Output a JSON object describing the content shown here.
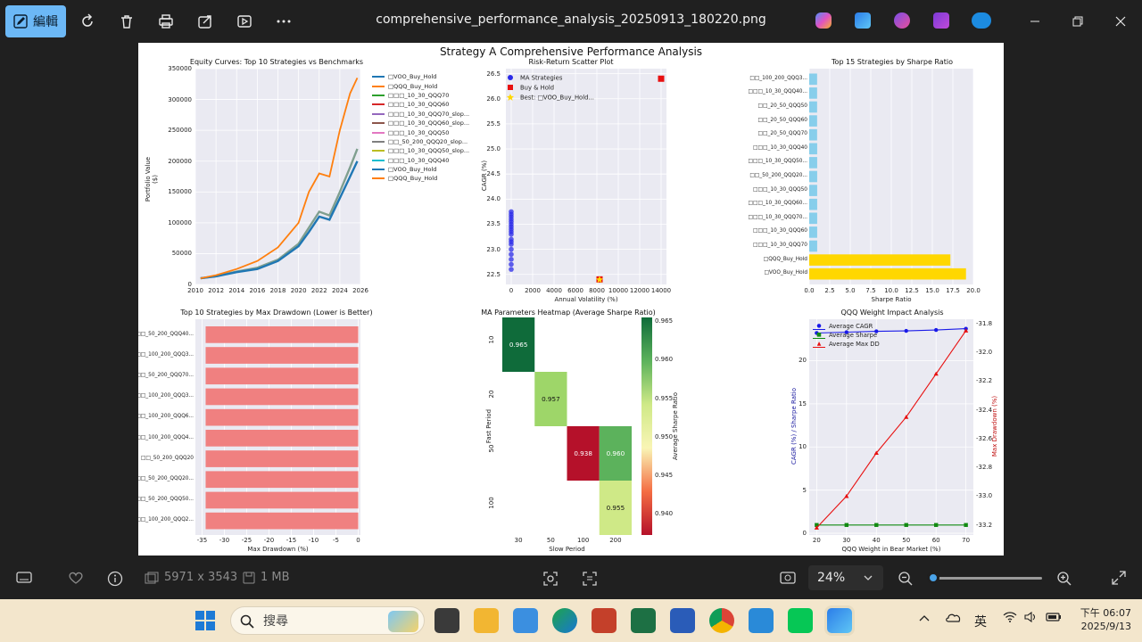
{
  "window": {
    "title": "comprehensive_performance_analysis_20250913_180220.png",
    "edit_label": "編輯"
  },
  "figure": {
    "title": "Strategy A Comprehensive Performance Analysis",
    "equity": {
      "title": "Equity Curves: Top 10 Strategies vs Benchmarks",
      "ylabel": "Portfolio Value ($)",
      "y_ticks": [
        "350000",
        "300000",
        "250000",
        "200000",
        "150000",
        "100000",
        "50000",
        "0"
      ],
      "x_ticks": [
        "2010",
        "2012",
        "2014",
        "2016",
        "2018",
        "2020",
        "2022",
        "2024",
        "2026"
      ],
      "legend": [
        {
          "name": "□VOO_Buy_Hold",
          "color": "#1f77b4"
        },
        {
          "name": "□QQQ_Buy_Hold",
          "color": "#ff7f0e"
        },
        {
          "name": "□□□_10_30_QQQ70",
          "color": "#2ca02c"
        },
        {
          "name": "□□□_10_30_QQQ60",
          "color": "#d62728"
        },
        {
          "name": "□□□_10_30_QQQ70_slop...",
          "color": "#9467bd"
        },
        {
          "name": "□□□_10_30_QQQ60_slop...",
          "color": "#8c564b"
        },
        {
          "name": "□□□_10_30_QQQ50",
          "color": "#e377c2"
        },
        {
          "name": "□□_50_200_QQQ20_slop...",
          "color": "#7f7f7f"
        },
        {
          "name": "□□□_10_30_QQQ50_slop...",
          "color": "#bcbd22"
        },
        {
          "name": "□□□_10_30_QQQ40",
          "color": "#17becf"
        },
        {
          "name": "□VOO_Buy_Hold",
          "color": "#1f77b4"
        },
        {
          "name": "□QQQ_Buy_Hold",
          "color": "#ff7f0e"
        }
      ]
    },
    "scatter": {
      "title": "Risk-Return Scatter Plot",
      "xlabel": "Annual Volatility (%)",
      "ylabel": "CAGR (%)",
      "y_ticks": [
        "26.5",
        "26.0",
        "25.5",
        "25.0",
        "24.5",
        "24.0",
        "23.5",
        "23.0",
        "22.5"
      ],
      "x_ticks": [
        "0",
        "2000",
        "4000",
        "6000",
        "8000",
        "10000",
        "12000",
        "14000"
      ],
      "legend": [
        "MA Strategies",
        "Buy & Hold",
        "Best: □VOO_Buy_Hold..."
      ]
    },
    "sharpe": {
      "title": "Top 15 Strategies by Sharpe Ratio",
      "xlabel": "Sharpe Ratio",
      "x_ticks": [
        "0.0",
        "2.5",
        "5.0",
        "7.5",
        "10.0",
        "12.5",
        "15.0",
        "17.5",
        "20.0"
      ],
      "labels": [
        "□□_100_200_QQQ3...",
        "□□□_10_30_QQQ40...",
        "□□_20_50_QQQ50",
        "□□_20_50_QQQ60",
        "□□_20_50_QQQ70",
        "□□□_10_30_QQQ40",
        "□□□_10_30_QQQ50...",
        "□□_50_200_QQQ20...",
        "□□□_10_30_QQQ50",
        "□□□_10_30_QQQ60...",
        "□□□_10_30_QQQ70...",
        "□□□_10_30_QQQ60",
        "□□□_10_30_QQQ70",
        "□QQQ_Buy_Hold",
        "□VOO_Buy_Hold"
      ],
      "colors": [
        "#87ceeb",
        "#87ceeb",
        "#87ceeb",
        "#87ceeb",
        "#87ceeb",
        "#87ceeb",
        "#87ceeb",
        "#87ceeb",
        "#87ceeb",
        "#87ceeb",
        "#87ceeb",
        "#87ceeb",
        "#87ceeb",
        "#ffd700",
        "#ffd700"
      ]
    },
    "drawdown": {
      "title": "Top 10 Strategies by Max Drawdown (Lower is Better)",
      "xlabel": "Max Drawdown (%)",
      "x_ticks": [
        "-35",
        "-30",
        "-25",
        "-20",
        "-15",
        "-10",
        "-5",
        "0"
      ],
      "labels": [
        "□□_50_200_QQQ40...",
        "□□_100_200_QQQ3...",
        "□□_50_200_QQQ70...",
        "□□_100_200_QQQ3...",
        "□□_100_200_QQQ6...",
        "□□_100_200_QQQ4...",
        "□□_50_200_QQQ20",
        "□□_50_200_QQQ20...",
        "□□_50_200_QQQ50...",
        "□□_100_200_QQQ2..."
      ]
    },
    "heatmap": {
      "title": "MA Parameters Heatmap (Average Sharpe Ratio)",
      "xlabel": "Slow Period",
      "ylabel": "Fast Period",
      "cbar_label": "Average Sharpe Ratio",
      "x_ticks": [
        "30",
        "50",
        "100",
        "200"
      ],
      "y_ticks": [
        "10",
        "20",
        "50",
        "100"
      ],
      "cbar_ticks": [
        "0.965",
        "0.960",
        "0.955",
        "0.950",
        "0.945",
        "0.940"
      ],
      "cells": [
        {
          "label": "0.965",
          "color": "#0f6b3a",
          "text": "#ffffff"
        },
        {
          "label": "0.957",
          "color": "#9ed669",
          "text": "#111111"
        },
        {
          "label": "0.938",
          "color": "#b5112a",
          "text": "#ffffff"
        },
        {
          "label": "0.960",
          "color": "#5cb25c",
          "text": "#ffffff"
        },
        {
          "label": "0.955",
          "color": "#cfe987",
          "text": "#111111"
        }
      ]
    },
    "qqq": {
      "title": "QQQ Weight Impact Analysis",
      "xlabel": "QQQ Weight in Bear Market (%)",
      "ylabel_left": "CAGR (%) / Sharpe Ratio",
      "ylabel_right": "Max Drawdown (%)",
      "x_ticks": [
        "20",
        "30",
        "40",
        "50",
        "60",
        "70"
      ],
      "y_ticks_left": [
        "20",
        "15",
        "10",
        "5",
        "0"
      ],
      "y_ticks_right": [
        "-31.8",
        "-32.0",
        "-32.2",
        "-32.4",
        "-32.6",
        "-32.8",
        "-33.0",
        "-33.2"
      ],
      "legend": [
        "Average CAGR",
        "Average Sharpe",
        "Average Max DD"
      ]
    }
  },
  "chart_data": [
    {
      "type": "line",
      "title": "Equity Curves: Top 10 Strategies vs Benchmarks",
      "ylabel": "Portfolio Value ($)",
      "x": [
        2010.5,
        2012,
        2014,
        2016,
        2018,
        2020,
        2021,
        2022,
        2023,
        2024,
        2025,
        2025.7
      ],
      "series": [
        {
          "name": "□QQQ_Buy_Hold",
          "values": [
            10000,
            15000,
            25000,
            38000,
            60000,
            100000,
            150000,
            180000,
            175000,
            250000,
            310000,
            335000
          ]
        },
        {
          "name": "□VOO_Buy_Hold",
          "values": [
            10000,
            13000,
            20000,
            25000,
            38000,
            62000,
            85000,
            110000,
            105000,
            140000,
            175000,
            200000
          ]
        },
        {
          "name": "□□□_10_30_QQQ70",
          "values": [
            10000,
            13500,
            21000,
            27000,
            40000,
            66000,
            92000,
            118000,
            112000,
            150000,
            190000,
            220000
          ]
        }
      ],
      "ylim": [
        0,
        350000
      ]
    },
    {
      "type": "scatter",
      "title": "Risk-Return Scatter Plot",
      "xlabel": "Annual Volatility (%)",
      "ylabel": "CAGR (%)",
      "series": [
        {
          "name": "MA Strategies",
          "x": [
            0,
            0,
            0,
            0,
            0,
            0,
            0,
            0,
            0,
            0,
            0,
            0,
            0,
            0,
            0,
            0,
            0,
            0
          ],
          "y": [
            22.6,
            22.7,
            22.8,
            22.9,
            23.0,
            23.1,
            23.15,
            23.2,
            23.3,
            23.35,
            23.4,
            23.45,
            23.5,
            23.55,
            23.6,
            23.65,
            23.7,
            23.75
          ]
        },
        {
          "name": "Buy & Hold",
          "x": [
            8250,
            14000
          ],
          "y": [
            22.4,
            26.4
          ]
        },
        {
          "name": "Best: □VOO_Buy_Hold...",
          "x": [
            8250
          ],
          "y": [
            22.4
          ]
        }
      ]
    },
    {
      "type": "bar",
      "title": "Top 15 Strategies by Sharpe Ratio",
      "xlabel": "Sharpe Ratio",
      "categories": [
        "□□_100_200_QQQ3...",
        "□□□_10_30_QQQ40...",
        "□□_20_50_QQQ50",
        "□□_20_50_QQQ60",
        "□□_20_50_QQQ70",
        "□□□_10_30_QQQ40",
        "□□□_10_30_QQQ50...",
        "□□_50_200_QQQ20...",
        "□□□_10_30_QQQ50",
        "□□□_10_30_QQQ60...",
        "□□□_10_30_QQQ70...",
        "□□□_10_30_QQQ60",
        "□□□_10_30_QQQ70",
        "□QQQ_Buy_Hold",
        "□VOO_Buy_Hold"
      ],
      "values": [
        0.96,
        0.96,
        0.96,
        0.96,
        0.96,
        0.97,
        0.97,
        0.97,
        0.97,
        0.97,
        0.97,
        0.97,
        0.97,
        17.2,
        19.1
      ],
      "xlim": [
        0,
        20
      ]
    },
    {
      "type": "bar",
      "title": "Top 10 Strategies by Max Drawdown (Lower is Better)",
      "xlabel": "Max Drawdown (%)",
      "categories": [
        "□□_50_200_QQQ40...",
        "□□_100_200_QQQ3...",
        "□□_50_200_QQQ70...",
        "□□_100_200_QQQ3...",
        "□□_100_200_QQQ6...",
        "□□_100_200_QQQ4...",
        "□□_50_200_QQQ20",
        "□□_50_200_QQQ20...",
        "□□_50_200_QQQ50...",
        "□□_100_200_QQQ2..."
      ],
      "values": [
        -34.2,
        -34.2,
        -34.2,
        -34.2,
        -34.2,
        -34.2,
        -34.2,
        -34.2,
        -34.2,
        -34.2
      ],
      "xlim": [
        -35,
        0
      ]
    },
    {
      "type": "heatmap",
      "title": "MA Parameters Heatmap (Average Sharpe Ratio)",
      "x": [
        "30",
        "50",
        "100",
        "200"
      ],
      "y": [
        "10",
        "20",
        "50",
        "100"
      ],
      "values": [
        [
          0.965,
          null,
          null,
          null
        ],
        [
          null,
          0.957,
          null,
          null
        ],
        [
          null,
          null,
          0.938,
          0.96
        ],
        [
          null,
          null,
          null,
          0.955
        ]
      ]
    },
    {
      "type": "line",
      "title": "QQQ Weight Impact Analysis",
      "xlabel": "QQQ Weight in Bear Market (%)",
      "x": [
        20,
        30,
        40,
        50,
        60,
        70
      ],
      "series": [
        {
          "name": "Average CAGR",
          "values": [
            23.2,
            23.3,
            23.4,
            23.45,
            23.55,
            23.7
          ]
        },
        {
          "name": "Average Sharpe",
          "values": [
            0.96,
            0.96,
            0.96,
            0.96,
            0.96,
            0.96
          ]
        },
        {
          "name": "Average Max DD",
          "values": [
            -33.22,
            -33.0,
            -32.7,
            -32.45,
            -32.15,
            -31.85
          ]
        }
      ]
    }
  ],
  "statusbar": {
    "dimensions": "5971 x 3543",
    "size": "1 MB",
    "zoom": "24%",
    "zoom_fraction": 0.05
  },
  "taskbar": {
    "search_placeholder": "搜尋",
    "ime": "英",
    "time": "下午 06:07",
    "date": "2025/9/13"
  }
}
